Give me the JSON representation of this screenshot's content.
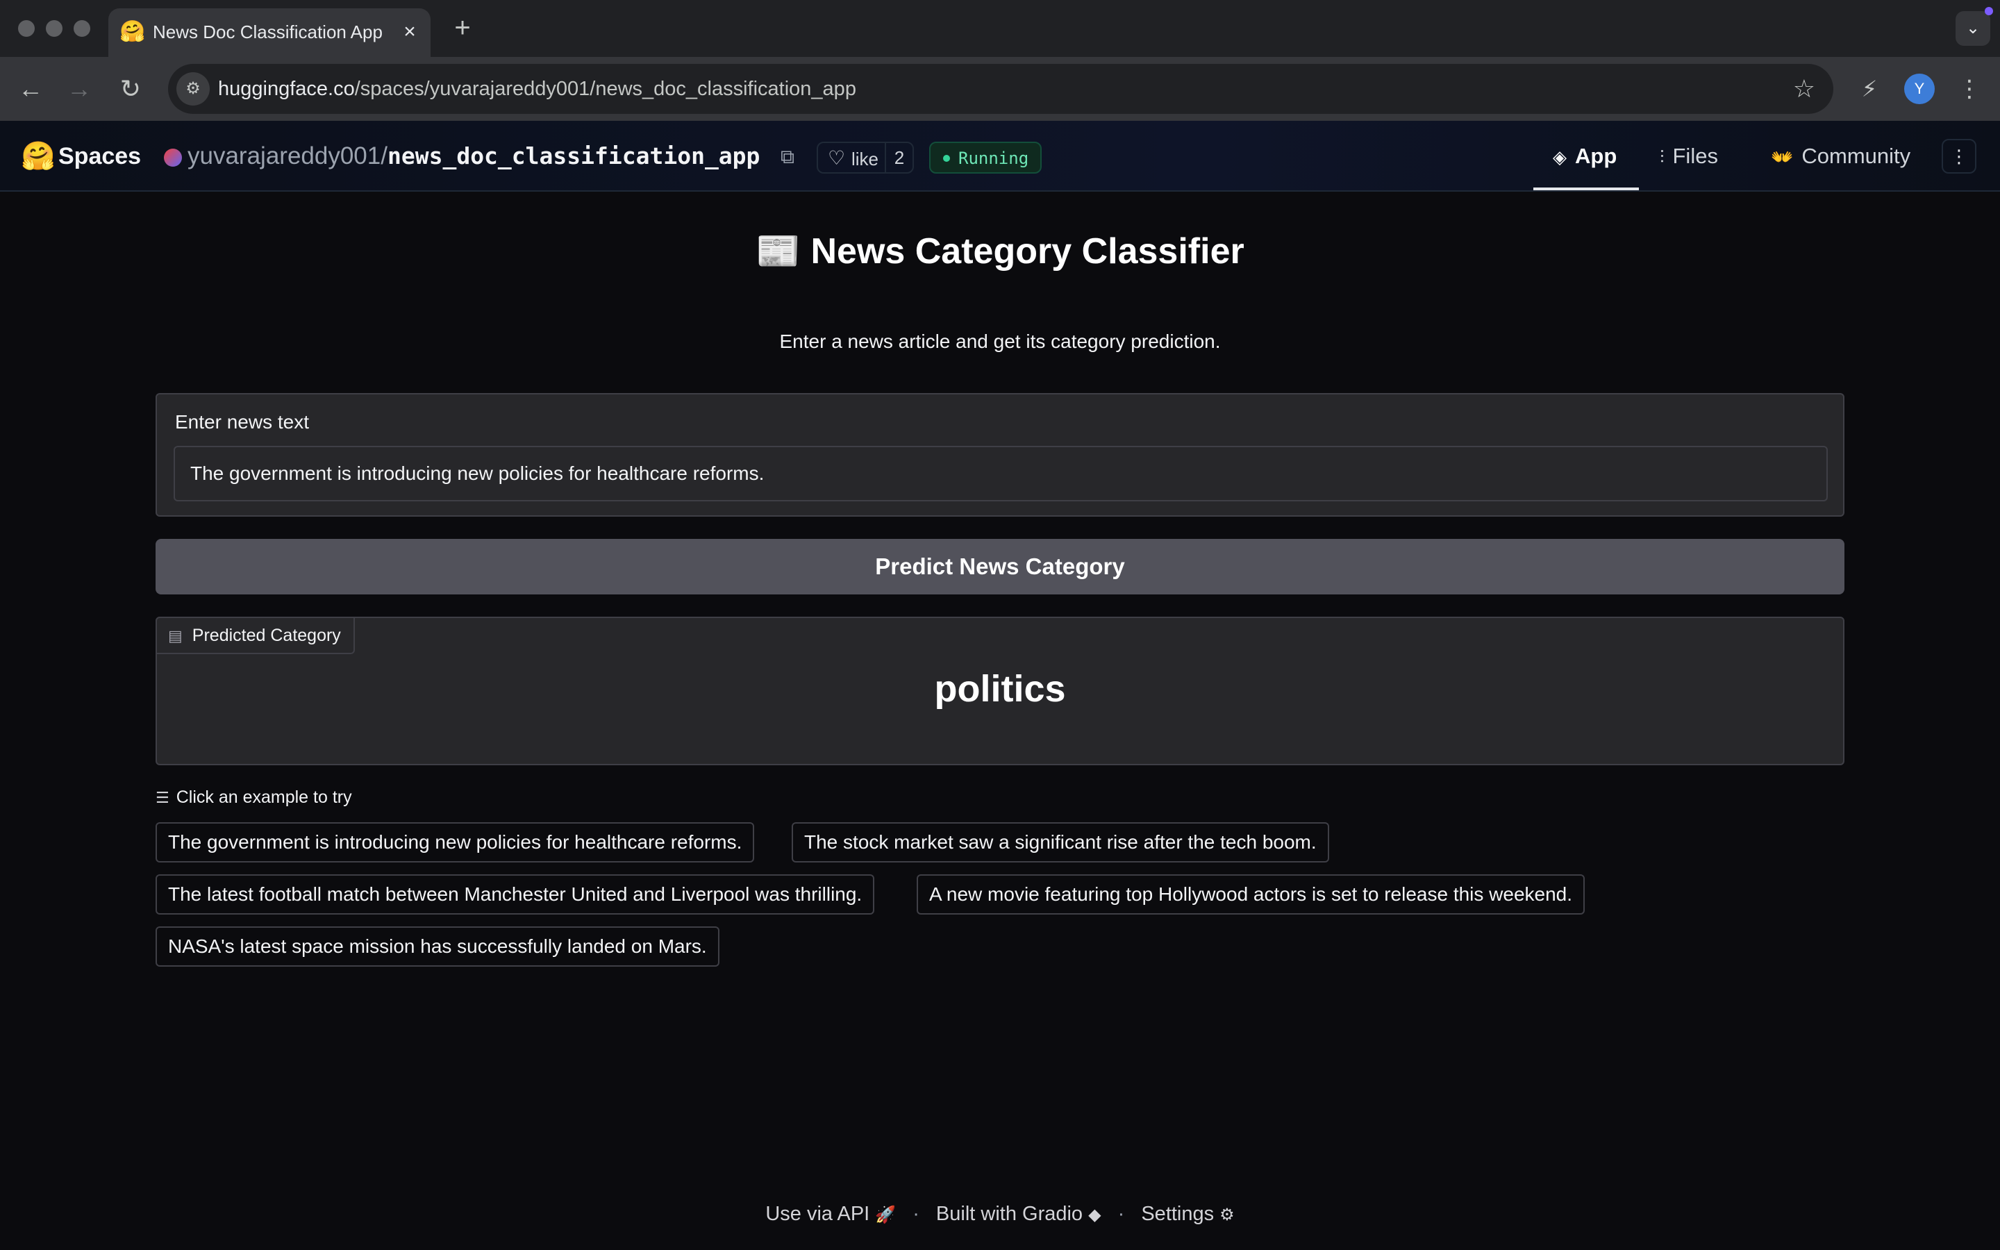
{
  "browser": {
    "tab_title": "News Doc Classification App",
    "url_host": "huggingface.co",
    "url_path": "/spaces/yuvarajareddy001/news_doc_classification_app",
    "profile_initial": "Y"
  },
  "header": {
    "spaces_label": "Spaces",
    "owner": "yuvarajareddy001",
    "separator": "/",
    "repo_name": "news_doc_classification_app",
    "like_label": "like",
    "like_count": "2",
    "status": "Running",
    "nav": {
      "app": "App",
      "files": "Files",
      "community": "Community"
    }
  },
  "app": {
    "title_icon": "📰",
    "title": "News Category Classifier",
    "description": "Enter a news article and get its category prediction.",
    "input_label": "Enter news text",
    "input_value": "The government is introducing new policies for healthcare reforms.",
    "predict_button": "Predict News Category",
    "output_label": "Predicted Category",
    "output_value": "politics",
    "examples_label": "Click an example to try",
    "examples": [
      "The government is introducing new policies for healthcare reforms.",
      "The stock market saw a significant rise after the tech boom.",
      "The latest football match between Manchester United and Liverpool was thrilling.",
      "A new movie featuring top Hollywood actors is set to release this weekend.",
      "NASA's latest space mission has successfully landed on Mars."
    ]
  },
  "footer": {
    "use_api": "Use via API",
    "built_with": "Built with Gradio",
    "settings": "Settings",
    "dot": "·"
  },
  "colors": {
    "app_bg": "#0b0b0e",
    "block_bg": "#27272a",
    "button_bg": "#52525b",
    "status_green": "#34d399"
  }
}
